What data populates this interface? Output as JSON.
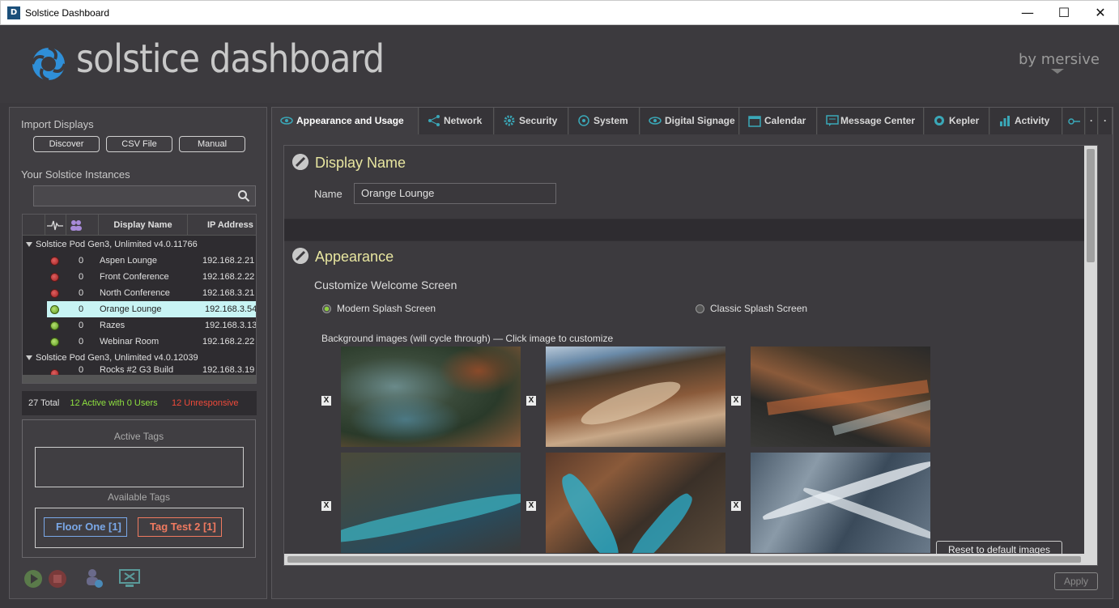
{
  "window": {
    "title": "Solstice Dashboard",
    "icon_letter": "D"
  },
  "header": {
    "logo_text": "solstice dashboard",
    "brand": "by mersive"
  },
  "left": {
    "import_label": "Import Displays",
    "buttons": [
      "Discover",
      "CSV File",
      "Manual"
    ],
    "instances_label": "Your Solstice Instances",
    "search_placeholder": "",
    "columns": [
      "Display Name",
      "IP Address"
    ],
    "groups": [
      {
        "label": "Solstice Pod Gen3, Unlimited v4.0.11766",
        "rows": [
          {
            "status": "red",
            "users": "0",
            "name": "Aspen Lounge",
            "ip": "192.168.2.21"
          },
          {
            "status": "red",
            "users": "0",
            "name": "Front Conference",
            "ip": "192.168.2.22"
          },
          {
            "status": "red",
            "users": "0",
            "name": "North Conference",
            "ip": "192.168.3.21"
          },
          {
            "status": "green",
            "users": "0",
            "name": "Orange Lounge",
            "ip": "192.168.3.54",
            "selected": true
          },
          {
            "status": "green",
            "users": "0",
            "name": "Razes",
            "ip": "192.168.3.13"
          },
          {
            "status": "green",
            "users": "0",
            "name": "Webinar Room",
            "ip": "192.168.2.22"
          }
        ]
      },
      {
        "label": "Solstice Pod Gen3, Unlimited v4.0.12039",
        "rows": [
          {
            "status": "red",
            "users": "0",
            "name": "Rocks #2 G3 Build",
            "ip": "192.168.3.19"
          }
        ]
      }
    ],
    "stats": {
      "total": "27 Total",
      "active": "12 Active with 0 Users",
      "unresponsive": "12 Unresponsive"
    },
    "active_tags_label": "Active Tags",
    "available_tags_label": "Available Tags",
    "tags": [
      "Floor One [1]",
      "Tag Test 2 [1]"
    ]
  },
  "tabs": [
    {
      "label": "Appearance and Usage",
      "icon": "eye-icon",
      "active": true
    },
    {
      "label": "Network",
      "icon": "network-icon"
    },
    {
      "label": "Security",
      "icon": "gear-icon"
    },
    {
      "label": "System",
      "icon": "target-icon"
    },
    {
      "label": "Digital Signage",
      "icon": "eye-icon"
    },
    {
      "label": "Calendar",
      "icon": "calendar-icon"
    },
    {
      "label": "Message Center",
      "icon": "message-icon"
    },
    {
      "label": "Kepler",
      "icon": "kepler-icon"
    },
    {
      "label": "Activity",
      "icon": "bar-chart-icon"
    }
  ],
  "display_name": {
    "title": "Display Name",
    "name_label": "Name",
    "name_value": "Orange Lounge"
  },
  "appearance": {
    "title": "Appearance",
    "customize_label": "Customize Welcome Screen",
    "option_modern": "Modern Splash Screen",
    "option_classic": "Classic Splash Screen",
    "selected_option": "modern",
    "bg_label": "Background images (will cycle through) — Click image to customize",
    "remove_label": "X",
    "reset_label": "Reset to default images"
  },
  "apply_label": "Apply",
  "colors": {
    "accent_title": "#e8e6a0",
    "active_count": "#8ee040",
    "unresponsive": "#f04a3a",
    "tag_blue": "#7aa8e8",
    "tag_red": "#f07a60"
  }
}
